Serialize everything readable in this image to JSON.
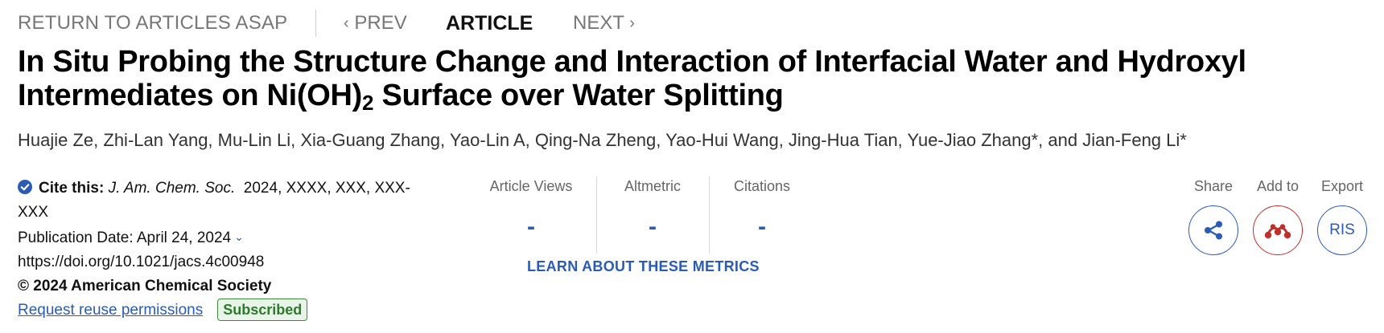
{
  "nav": {
    "return_label": "RETURN TO ARTICLES ASAP",
    "prev_label": "PREV",
    "current_label": "ARTICLE",
    "next_label": "NEXT"
  },
  "article": {
    "title_part1": "In Situ Probing the Structure Change and Interaction of Interfacial Water and Hydroxyl Intermediates on Ni(OH)",
    "title_sub": "2",
    "title_part2": " Surface over Water Splitting",
    "authors": "Huajie Ze, Zhi-Lan Yang, Mu-Lin Li, Xia-Guang Zhang, Yao-Lin A, Qing-Na Zheng, Yao-Hui Wang, Jing-Hua Tian, Yue-Jiao Zhang*, and Jian-Feng Li*"
  },
  "cite": {
    "label": "Cite this:",
    "journal": "J. Am. Chem. Soc.",
    "details": "2024, XXXX, XXX, XXX-XXX",
    "publication_date": "Publication Date: April 24, 2024",
    "doi": "https://doi.org/10.1021/jacs.4c00948",
    "copyright": "© 2024 American Chemical Society",
    "reuse_link": "Request reuse permissions",
    "access_badge": "Subscribed"
  },
  "metrics": {
    "items": [
      {
        "label": "Article Views",
        "value": "-"
      },
      {
        "label": "Altmetric",
        "value": "-"
      },
      {
        "label": "Citations",
        "value": "-"
      }
    ],
    "learn_link": "LEARN ABOUT THESE METRICS"
  },
  "actions": {
    "share_label": "Share",
    "add_label": "Add to",
    "export_label": "Export",
    "export_button_text": "RIS"
  },
  "icons": {
    "check": "check-circle-icon",
    "share": "share-icon",
    "mendeley": "mendeley-icon"
  },
  "colors": {
    "accent_blue": "#2a5bb5",
    "mendeley_red": "#c0302a",
    "subscribed_green": "#2d7a2d"
  }
}
